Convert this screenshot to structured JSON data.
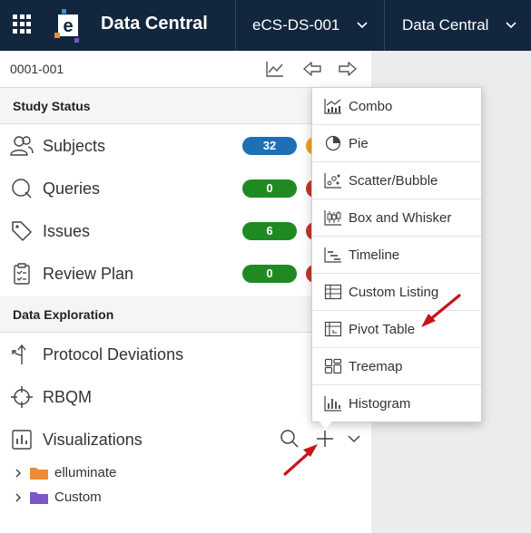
{
  "header": {
    "app_title": "Data Central",
    "study_selector": "eCS-DS-001",
    "module_selector": "Data Central"
  },
  "toolbar": {
    "breadcrumb": "0001-001"
  },
  "study_status": {
    "title": "Study Status",
    "items": [
      {
        "label": "Subjects",
        "count": "32"
      },
      {
        "label": "Queries",
        "count": "0"
      },
      {
        "label": "Issues",
        "count": "6"
      },
      {
        "label": "Review Plan",
        "count": "0"
      }
    ]
  },
  "data_exploration": {
    "title": "Data Exploration",
    "items": [
      {
        "label": "Protocol Deviations"
      },
      {
        "label": "RBQM"
      },
      {
        "label": "Visualizations"
      }
    ]
  },
  "tree": [
    {
      "label": "elluminate",
      "color": "#f08a35"
    },
    {
      "label": "Custom",
      "color": "#7b55c9"
    }
  ],
  "menu": {
    "items": [
      {
        "label": "Combo",
        "icon": "combo-chart-icon"
      },
      {
        "label": "Pie",
        "icon": "pie-chart-icon"
      },
      {
        "label": "Scatter/Bubble",
        "icon": "scatter-chart-icon"
      },
      {
        "label": "Box and Whisker",
        "icon": "box-whisker-icon"
      },
      {
        "label": "Timeline",
        "icon": "timeline-icon"
      },
      {
        "label": "Custom Listing",
        "icon": "table-icon"
      },
      {
        "label": "Pivot Table",
        "icon": "pivot-table-icon"
      },
      {
        "label": "Treemap",
        "icon": "treemap-icon"
      },
      {
        "label": "Histogram",
        "icon": "histogram-icon"
      }
    ]
  },
  "colors": {
    "topbar": "#12263e",
    "badge_blue": "#1f6fb5",
    "badge_green": "#1f8a22",
    "annotation_arrow": "#c4161c"
  }
}
